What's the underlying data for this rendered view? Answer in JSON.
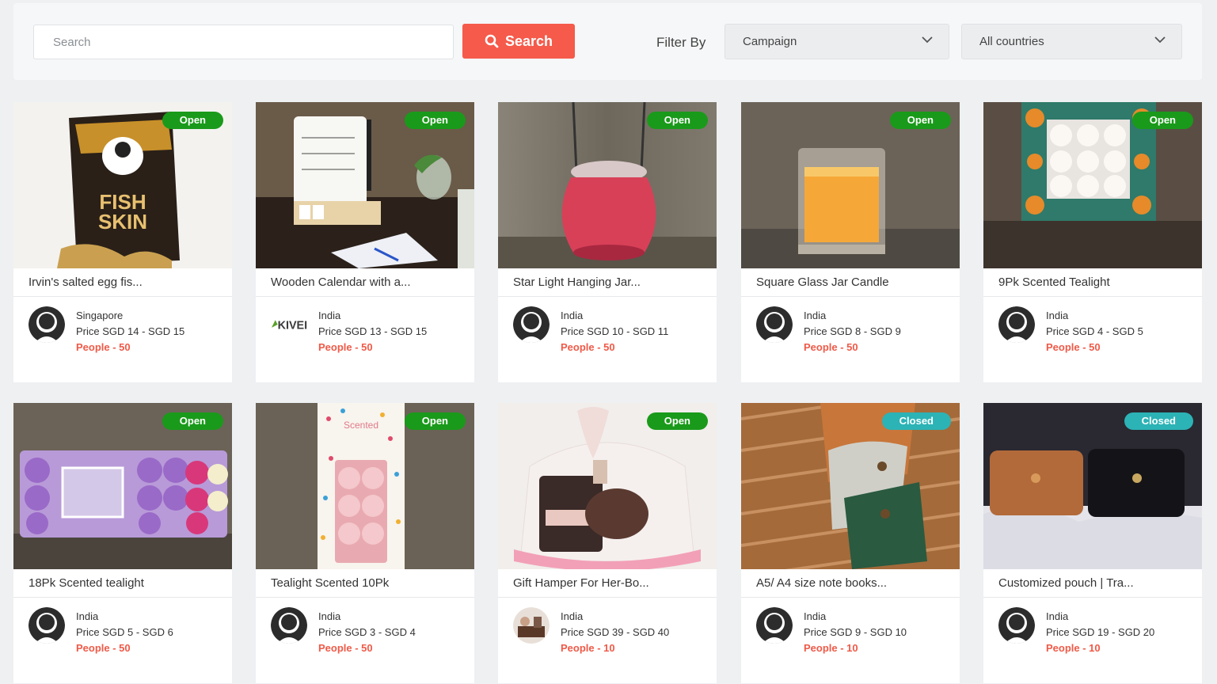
{
  "search": {
    "placeholder": "Search",
    "button_label": "Search"
  },
  "filter": {
    "label": "Filter By",
    "campaign": "Campaign",
    "countries": "All countries"
  },
  "colors": {
    "accent": "#f55a4a",
    "open": "#1a9a1a",
    "closed": "#2cb3b6",
    "people": "#ef5a48"
  },
  "cards": [
    {
      "title": "Irvin's salted egg fis...",
      "status": "Open",
      "country": "Singapore",
      "price": "Price SGD 14 - SGD 15",
      "people": "People - 50",
      "avatar": "default-avatar-icon"
    },
    {
      "title": "Wooden Calendar with a...",
      "status": "Open",
      "country": "India",
      "price": "Price SGD 13 - SGD 15",
      "people": "People - 50",
      "avatar": "kivei-logo",
      "logo_text": "KIVEI"
    },
    {
      "title": "Star Light Hanging Jar...",
      "status": "Open",
      "country": "India",
      "price": "Price SGD 10 - SGD 11",
      "people": "People - 50",
      "avatar": "default-avatar-icon"
    },
    {
      "title": "Square Glass Jar Candle",
      "status": "Open",
      "country": "India",
      "price": "Price SGD 8 - SGD 9",
      "people": "People - 50",
      "avatar": "default-avatar-icon"
    },
    {
      "title": "9Pk Scented Tealight",
      "status": "Open",
      "country": "India",
      "price": "Price SGD 4 - SGD 5",
      "people": "People - 50",
      "avatar": "default-avatar-icon"
    },
    {
      "title": "18Pk Scented tealight",
      "status": "Open",
      "country": "India",
      "price": "Price SGD 5 - SGD 6",
      "people": "People - 50",
      "avatar": "default-avatar-icon"
    },
    {
      "title": "Tealight Scented 10Pk",
      "status": "Open",
      "country": "India",
      "price": "Price SGD 3 - SGD 4",
      "people": "People - 50",
      "avatar": "default-avatar-icon"
    },
    {
      "title": "Gift Hamper For Her-Bo...",
      "status": "Open",
      "country": "India",
      "price": "Price SGD 39 - SGD 40",
      "people": "People - 10",
      "avatar": "photo-avatar"
    },
    {
      "title": "A5/ A4 size note books...",
      "status": "Closed",
      "country": "India",
      "price": "Price SGD 9 - SGD 10",
      "people": "People - 10",
      "avatar": "default-avatar-icon"
    },
    {
      "title": "Customized pouch | Tra...",
      "status": "Closed",
      "country": "India",
      "price": "Price SGD 19 - SGD 20",
      "people": "People - 10",
      "avatar": "default-avatar-icon"
    }
  ]
}
